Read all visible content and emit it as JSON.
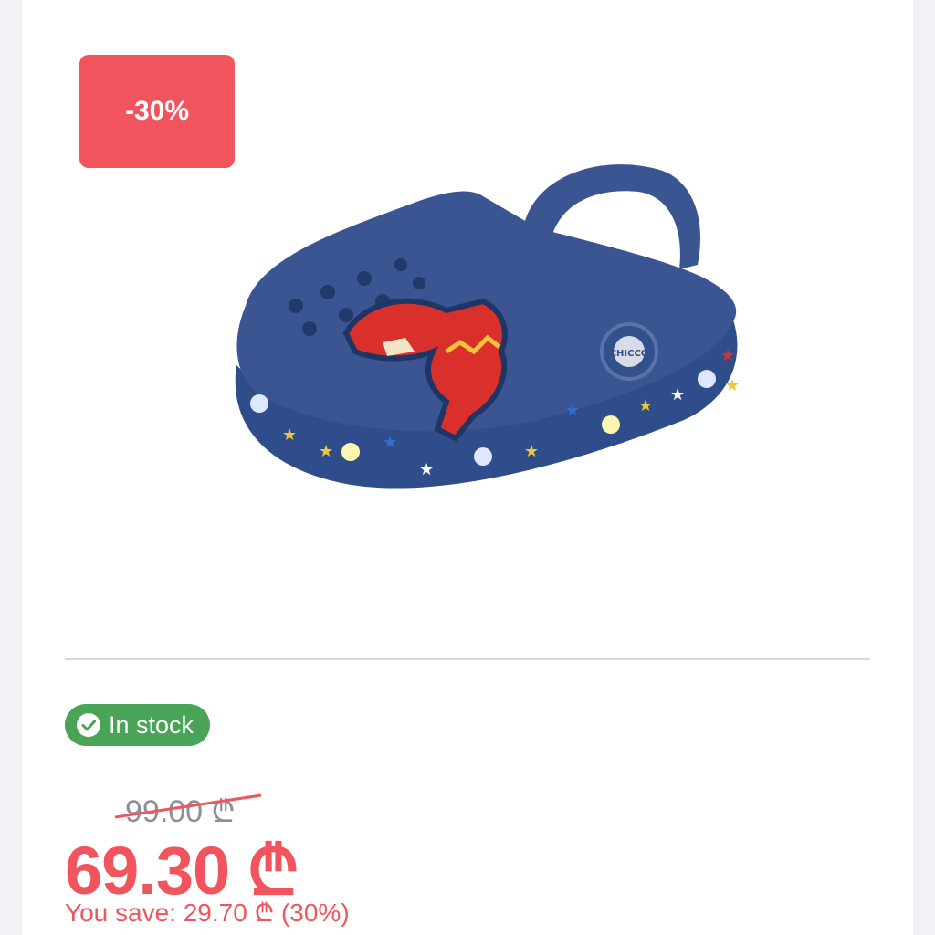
{
  "product": {
    "discount_badge": "-30%",
    "stock_label": "In stock",
    "old_price": "99.00 ₾",
    "new_price": "69.30 ₾",
    "savings_text": "You save: 29.70 ₾ (30%)",
    "shoe_brand_mark": "CHICCO"
  },
  "colors": {
    "discount": "#f2545e",
    "in_stock": "#4aa457",
    "old_price": "#8b8f97"
  },
  "icons": {
    "stock": "check-circle-icon"
  }
}
